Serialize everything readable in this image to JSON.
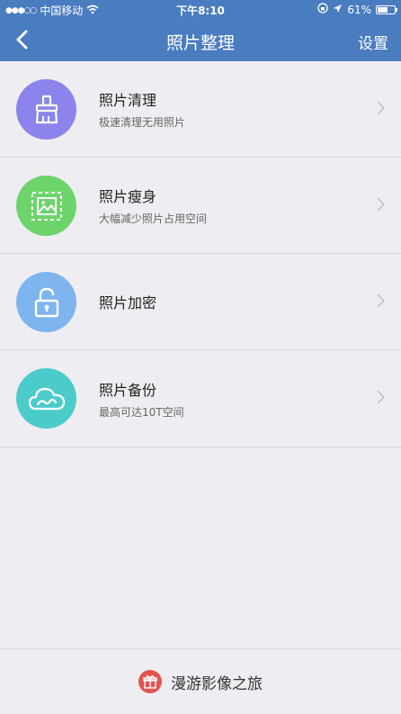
{
  "status_bar": {
    "signal": "●●●○○",
    "carrier": "中国移动",
    "time": "下午8:10",
    "battery": "61%",
    "battery_level": 0.61
  },
  "header": {
    "title": "照片整理",
    "settings_label": "设置",
    "bg_color": "#4a7cc0"
  },
  "items": [
    {
      "title": "照片清理",
      "subtitle": "极速清理无用照片",
      "icon": "broom-icon",
      "color": "#8c84ec"
    },
    {
      "title": "照片瘦身",
      "subtitle": "大幅减少照片占用空间",
      "icon": "image-compress-icon",
      "color": "#6dd46b"
    },
    {
      "title": "照片加密",
      "subtitle": "",
      "icon": "lock-icon",
      "color": "#7fb5ee"
    },
    {
      "title": "照片备份",
      "subtitle": "最高可达10T空间",
      "icon": "cloud-icon",
      "color": "#4ccbcb"
    }
  ],
  "footer": {
    "label": "漫游影像之旅",
    "icon": "gift-icon",
    "color": "#e05550"
  }
}
